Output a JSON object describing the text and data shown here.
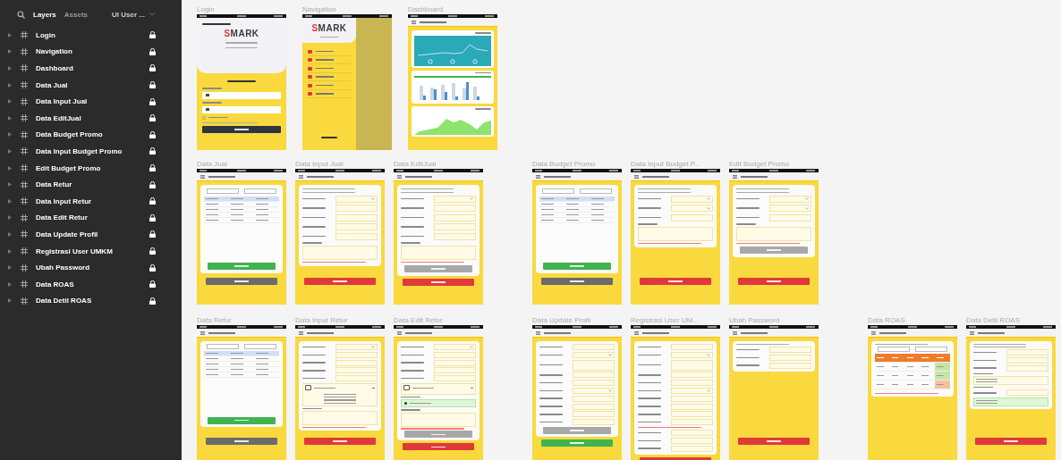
{
  "layers_panel": {
    "tabs": [
      {
        "label": "Layers",
        "selected": true
      },
      {
        "label": "Assets",
        "selected": false
      }
    ],
    "page_selector": "UI User ...",
    "layers": [
      {
        "name": "Login",
        "locked": true
      },
      {
        "name": "Navigation",
        "locked": true
      },
      {
        "name": "Dashboard",
        "locked": true
      },
      {
        "name": "Data Jual",
        "locked": true
      },
      {
        "name": "Data Input Jual",
        "locked": true
      },
      {
        "name": "Data EditJual",
        "locked": true
      },
      {
        "name": "Data Budget Promo",
        "locked": true
      },
      {
        "name": "Data Input Budget Promo",
        "locked": true
      },
      {
        "name": "Edit Budget Promo",
        "locked": true
      },
      {
        "name": "Data Retur",
        "locked": true
      },
      {
        "name": "Data Input Retur",
        "locked": true
      },
      {
        "name": "Data Edit Retur",
        "locked": true
      },
      {
        "name": "Data Update Profil",
        "locked": true
      },
      {
        "name": "Registrasi User UMKM",
        "locked": true
      },
      {
        "name": "Ubah Password",
        "locked": true
      },
      {
        "name": "Data ROAS",
        "locked": true
      },
      {
        "name": "Data Detil ROAS",
        "locked": true
      }
    ]
  },
  "canvas": {
    "rows": [
      {
        "groups": [
          [
            {
              "title": "Login",
              "kind": "login",
              "card": [
                {
                  "kind": "heading"
                },
                {
                  "kind": "logo",
                  "first": "S",
                  "rest": "MARK"
                },
                {
                  "kind": "note"
                },
                {
                  "kind": "note"
                }
              ],
              "body": [
                {
                  "kind": "heading"
                },
                {
                  "kind": "label"
                },
                {
                  "kind": "input"
                },
                {
                  "kind": "label"
                },
                {
                  "kind": "input"
                },
                {
                  "kind": "check"
                },
                {
                  "kind": "note"
                },
                {
                  "kind": "button",
                  "color": "#2f3540"
                }
              ]
            },
            {
              "title": "Navigation",
              "kind": "drawer",
              "card": [
                {
                  "kind": "logo",
                  "first": "S",
                  "rest": "MARK"
                },
                {
                  "kind": "note"
                }
              ],
              "body": [
                {
                  "kind": "nav"
                },
                {
                  "kind": "nav"
                },
                {
                  "kind": "nav"
                },
                {
                  "kind": "nav"
                },
                {
                  "kind": "nav"
                },
                {
                  "kind": "nav"
                },
                {
                  "kind": "signout"
                }
              ]
            },
            {
              "title": "Dashboard",
              "kind": "screen",
              "body": [
                {
                  "kind": "line_chart"
                },
                {
                  "kind": "bar_chart"
                },
                {
                  "kind": "area_chart"
                }
              ]
            }
          ]
        ]
      },
      {
        "groups": [
          [
            {
              "title": "Data Jual",
              "kind": "screen",
              "card": [
                {
                  "kind": "period"
                },
                {
                  "kind": "table"
                },
                {
                  "kind": "button",
                  "color": "#3fb34f"
                }
              ],
              "footer": [
                {
                  "kind": "button",
                  "color": "#6b6b6b"
                }
              ]
            },
            {
              "title": "Data Input Jual",
              "kind": "screen",
              "card": [
                {
                  "kind": "note"
                },
                {
                  "kind": "note"
                },
                {
                  "kind": "select_field"
                },
                {
                  "kind": "field"
                },
                {
                  "kind": "field"
                },
                {
                  "kind": "field"
                },
                {
                  "kind": "field"
                },
                {
                  "kind": "area"
                },
                {
                  "kind": "error"
                }
              ],
              "footer": [
                {
                  "kind": "button",
                  "color": "#e0393a"
                }
              ]
            },
            {
              "title": "Data EditJual",
              "kind": "screen",
              "card": [
                {
                  "kind": "note"
                },
                {
                  "kind": "note"
                },
                {
                  "kind": "select_field"
                },
                {
                  "kind": "field"
                },
                {
                  "kind": "field"
                },
                {
                  "kind": "field"
                },
                {
                  "kind": "field"
                },
                {
                  "kind": "area"
                },
                {
                  "kind": "error"
                },
                {
                  "kind": "button",
                  "color": "#a8a8a8"
                }
              ],
              "footer": [
                {
                  "kind": "button",
                  "color": "#e0393a"
                }
              ]
            }
          ],
          [
            {
              "title": "Data Budget Promo",
              "kind": "screen",
              "card": [
                {
                  "kind": "period"
                },
                {
                  "kind": "table"
                },
                {
                  "kind": "button",
                  "color": "#3fb34f"
                }
              ],
              "footer": [
                {
                  "kind": "button",
                  "color": "#6b6b6b"
                }
              ]
            },
            {
              "title": "Data Input Budget P...",
              "kind": "screen",
              "card": [
                {
                  "kind": "note"
                },
                {
                  "kind": "note"
                },
                {
                  "kind": "select_field"
                },
                {
                  "kind": "select_field"
                },
                {
                  "kind": "field"
                },
                {
                  "kind": "area"
                },
                {
                  "kind": "error"
                }
              ],
              "footer": [
                {
                  "kind": "button",
                  "color": "#e0393a"
                }
              ]
            },
            {
              "title": "Edit Budget Promo",
              "kind": "screen",
              "card": [
                {
                  "kind": "note"
                },
                {
                  "kind": "note"
                },
                {
                  "kind": "select_field"
                },
                {
                  "kind": "select_field"
                },
                {
                  "kind": "field"
                },
                {
                  "kind": "area"
                },
                {
                  "kind": "error"
                },
                {
                  "kind": "button",
                  "color": "#a8a8a8"
                }
              ],
              "footer": [
                {
                  "kind": "button",
                  "color": "#e0393a"
                }
              ]
            }
          ]
        ]
      },
      {
        "groups": [
          [
            {
              "title": "Data Retur",
              "kind": "screen",
              "card": [
                {
                  "kind": "period"
                },
                {
                  "kind": "table"
                },
                {
                  "kind": "button",
                  "color": "#3fb34f"
                }
              ],
              "footer": [
                {
                  "kind": "button",
                  "color": "#6b6b6b"
                }
              ]
            },
            {
              "title": "Data Input Retur",
              "kind": "screen",
              "card": [
                {
                  "kind": "select_field"
                },
                {
                  "kind": "field"
                },
                {
                  "kind": "field"
                },
                {
                  "kind": "field"
                },
                {
                  "kind": "field"
                },
                {
                  "kind": "dropdown"
                },
                {
                  "kind": "area"
                },
                {
                  "kind": "error"
                }
              ],
              "footer": [
                {
                  "kind": "button",
                  "color": "#e0393a"
                }
              ]
            },
            {
              "title": "Data Edit Retur",
              "kind": "screen",
              "card": [
                {
                  "kind": "select_field"
                },
                {
                  "kind": "field"
                },
                {
                  "kind": "field"
                },
                {
                  "kind": "field"
                },
                {
                  "kind": "field"
                },
                {
                  "kind": "dropdown_closed"
                },
                {
                  "kind": "label"
                },
                {
                  "kind": "status"
                },
                {
                  "kind": "area"
                },
                {
                  "kind": "error"
                },
                {
                  "kind": "button",
                  "color": "#a8a8a8"
                }
              ],
              "footer": [
                {
                  "kind": "button",
                  "color": "#e0393a"
                }
              ]
            }
          ],
          [
            {
              "title": "Data Update Profil",
              "kind": "screen",
              "card": [
                {
                  "kind": "field"
                },
                {
                  "kind": "select_field"
                },
                {
                  "kind": "tall_field"
                },
                {
                  "kind": "field"
                },
                {
                  "kind": "field"
                },
                {
                  "kind": "select_field"
                },
                {
                  "kind": "field"
                },
                {
                  "kind": "field"
                },
                {
                  "kind": "field"
                },
                {
                  "kind": "field"
                },
                {
                  "kind": "button",
                  "color": "#a8a8a8"
                }
              ],
              "footer": [
                {
                  "kind": "button",
                  "color": "#3fb34f"
                }
              ]
            },
            {
              "title": "Registrasi User UM...",
              "kind": "screen",
              "card": [
                {
                  "kind": "field"
                },
                {
                  "kind": "select_field"
                },
                {
                  "kind": "tall_field"
                },
                {
                  "kind": "field"
                },
                {
                  "kind": "field"
                },
                {
                  "kind": "select_field"
                },
                {
                  "kind": "field"
                },
                {
                  "kind": "field"
                },
                {
                  "kind": "field"
                },
                {
                  "kind": "field"
                },
                {
                  "kind": "error"
                },
                {
                  "kind": "field"
                },
                {
                  "kind": "field"
                },
                {
                  "kind": "field"
                }
              ],
              "footer": [
                {
                  "kind": "button",
                  "color": "#e0393a"
                }
              ]
            },
            {
              "title": "Ubah Password",
              "kind": "screen",
              "card": [
                {
                  "kind": "note"
                },
                {
                  "kind": "field"
                },
                {
                  "kind": "field"
                },
                {
                  "kind": "field"
                }
              ],
              "footer": [
                {
                  "kind": "button",
                  "color": "#e0393a"
                }
              ]
            }
          ],
          [
            {
              "title": "Data ROAS",
              "kind": "screen",
              "card": [
                {
                  "kind": "note"
                },
                {
                  "kind": "period"
                },
                {
                  "kind": "roas_table"
                },
                {
                  "kind": "error"
                }
              ]
            },
            {
              "title": "Data Detil ROAS",
              "kind": "screen",
              "card": [
                {
                  "kind": "note"
                },
                {
                  "kind": "note"
                },
                {
                  "kind": "field"
                },
                {
                  "kind": "field"
                },
                {
                  "kind": "field"
                },
                {
                  "kind": "label"
                },
                {
                  "kind": "box"
                },
                {
                  "kind": "label"
                },
                {
                  "kind": "field"
                },
                {
                  "kind": "success"
                }
              ],
              "footer": [
                {
                  "kind": "button",
                  "color": "#e0393a"
                }
              ]
            }
          ]
        ]
      }
    ]
  }
}
